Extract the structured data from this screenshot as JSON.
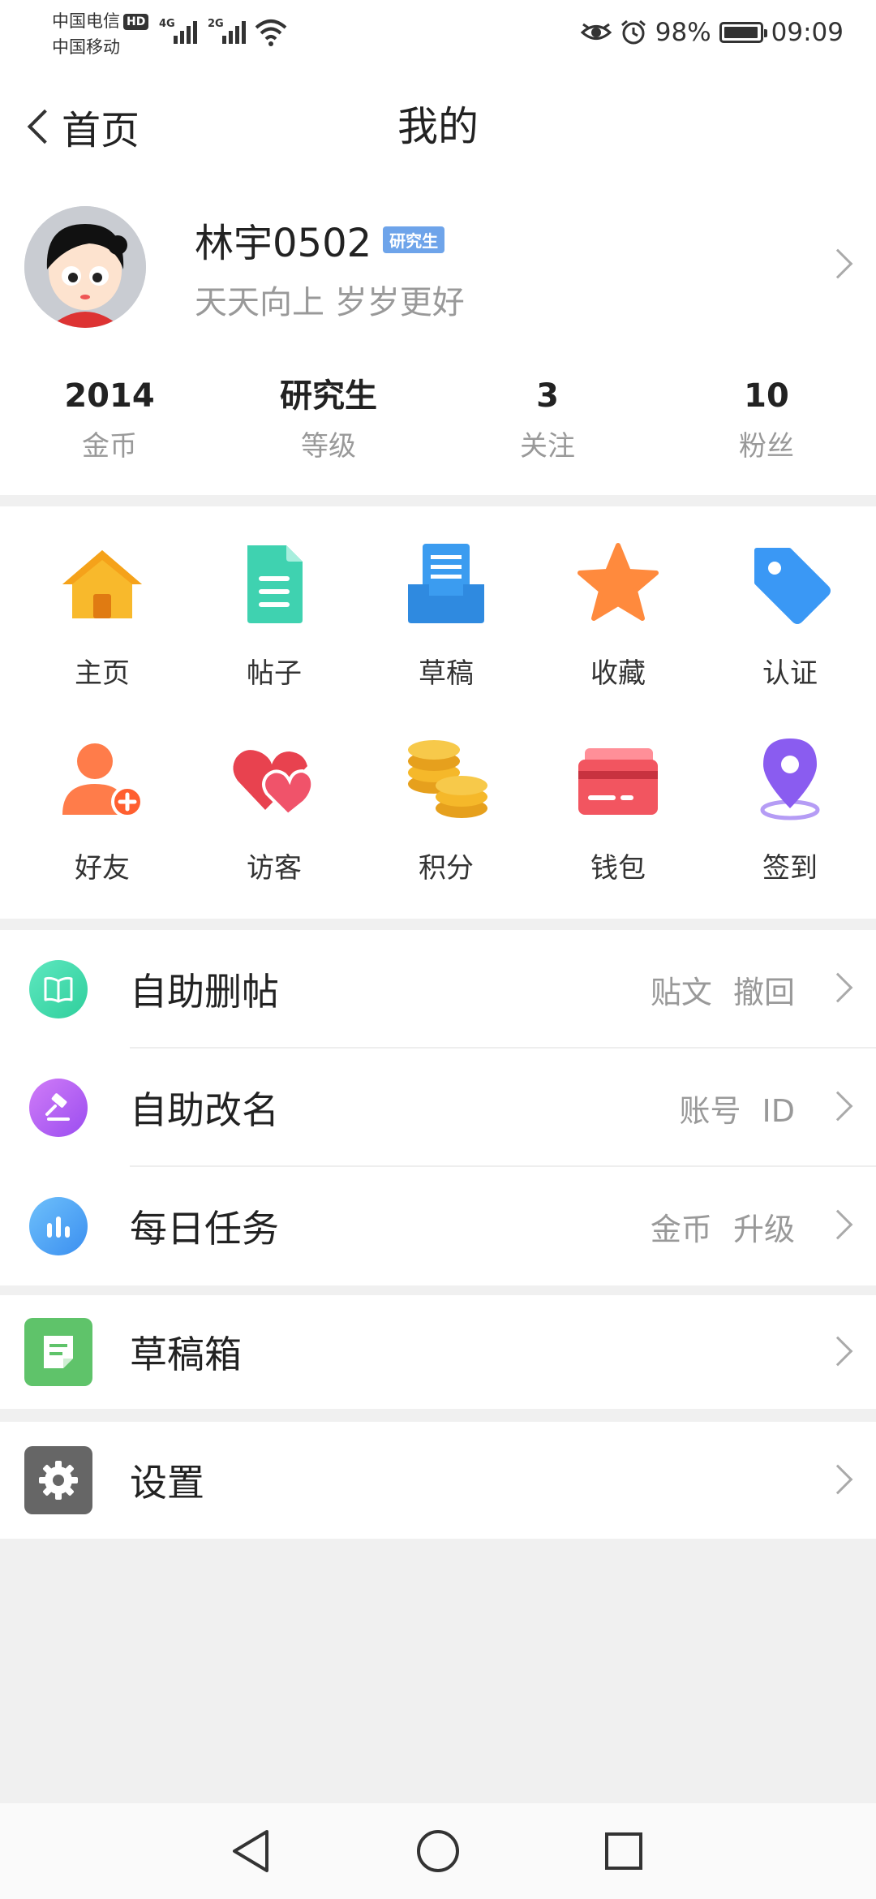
{
  "status_bar": {
    "carrier1": "中国电信",
    "hd_badge": "HD",
    "carrier2": "中国移动",
    "network1": "4G",
    "network2": "2G",
    "battery_percent": "98%",
    "battery_level": 0.98,
    "time": "09:09",
    "icons": [
      "eye-icon",
      "alarm-icon",
      "wifi-icon",
      "signal-icon",
      "battery-icon"
    ]
  },
  "header": {
    "back_label": "首页",
    "title": "我的"
  },
  "profile": {
    "username": "林宇0502",
    "level_badge": "研究生",
    "motto": "天天向上 岁岁更好",
    "stats": [
      {
        "value": "2014",
        "label": "金币"
      },
      {
        "value": "研究生",
        "label": "等级"
      },
      {
        "value": "3",
        "label": "关注"
      },
      {
        "value": "10",
        "label": "粉丝"
      }
    ]
  },
  "grid": {
    "items": [
      {
        "label": "主页",
        "icon": "home-icon",
        "color": "#f8b92c"
      },
      {
        "label": "帖子",
        "icon": "document-icon",
        "color": "#3fd2b0"
      },
      {
        "label": "草稿",
        "icon": "draft-tray-icon",
        "color": "#3b9cf0"
      },
      {
        "label": "收藏",
        "icon": "star-icon",
        "color": "#ff8a3d"
      },
      {
        "label": "认证",
        "icon": "tag-icon",
        "color": "#3a98f5"
      },
      {
        "label": "好友",
        "icon": "add-friend-icon",
        "color": "#ff7c4a"
      },
      {
        "label": "访客",
        "icon": "hearts-icon",
        "color": "#f0536a"
      },
      {
        "label": "积分",
        "icon": "coins-icon",
        "color": "#f5b82a"
      },
      {
        "label": "钱包",
        "icon": "wallet-card-icon",
        "color": "#f25560"
      },
      {
        "label": "签到",
        "icon": "location-pin-icon",
        "color": "#8a5cf0"
      }
    ]
  },
  "tools": [
    {
      "label": "自助删帖",
      "tags": "贴文 撤回",
      "icon": "book-icon",
      "color": "#3fd7a8"
    },
    {
      "label": "自助改名",
      "tags": "账号 ID",
      "icon": "gavel-icon",
      "color": "#b45ff2"
    },
    {
      "label": "每日任务",
      "tags": "金币 升级",
      "icon": "bar-chart-icon",
      "color": "#4aa6f5"
    }
  ],
  "drafts_box": {
    "label": "草稿箱",
    "icon": "note-icon",
    "color": "#5fc36a"
  },
  "settings": {
    "label": "设置",
    "icon": "gear-icon",
    "color": "#666666"
  }
}
